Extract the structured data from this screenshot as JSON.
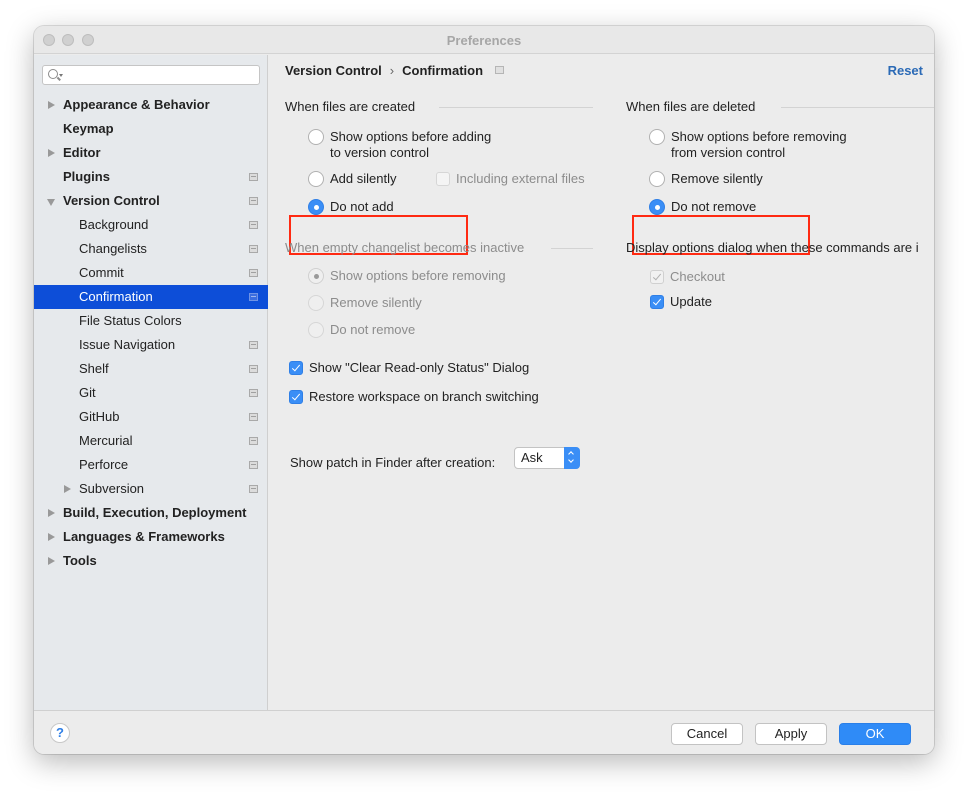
{
  "window": {
    "title": "Preferences"
  },
  "sidebar": {
    "search": {
      "placeholder": "",
      "value": ""
    },
    "items": [
      {
        "label": "Appearance & Behavior",
        "level": 0,
        "expander": "collapsed",
        "project_icon": false,
        "selected": false
      },
      {
        "label": "Keymap",
        "level": 0,
        "expander": "none",
        "project_icon": false,
        "selected": false
      },
      {
        "label": "Editor",
        "level": 0,
        "expander": "collapsed",
        "project_icon": false,
        "selected": false
      },
      {
        "label": "Plugins",
        "level": 0,
        "expander": "none",
        "project_icon": true,
        "selected": false
      },
      {
        "label": "Version Control",
        "level": 0,
        "expander": "expanded",
        "project_icon": true,
        "selected": false
      },
      {
        "label": "Background",
        "level": 1,
        "expander": "none",
        "project_icon": true,
        "selected": false
      },
      {
        "label": "Changelists",
        "level": 1,
        "expander": "none",
        "project_icon": true,
        "selected": false
      },
      {
        "label": "Commit",
        "level": 1,
        "expander": "none",
        "project_icon": true,
        "selected": false
      },
      {
        "label": "Confirmation",
        "level": 1,
        "expander": "none",
        "project_icon": true,
        "selected": true
      },
      {
        "label": "File Status Colors",
        "level": 1,
        "expander": "none",
        "project_icon": false,
        "selected": false
      },
      {
        "label": "Issue Navigation",
        "level": 1,
        "expander": "none",
        "project_icon": true,
        "selected": false
      },
      {
        "label": "Shelf",
        "level": 1,
        "expander": "none",
        "project_icon": true,
        "selected": false
      },
      {
        "label": "Git",
        "level": 1,
        "expander": "none",
        "project_icon": true,
        "selected": false
      },
      {
        "label": "GitHub",
        "level": 1,
        "expander": "none",
        "project_icon": true,
        "selected": false
      },
      {
        "label": "Mercurial",
        "level": 1,
        "expander": "none",
        "project_icon": true,
        "selected": false
      },
      {
        "label": "Perforce",
        "level": 1,
        "expander": "none",
        "project_icon": true,
        "selected": false
      },
      {
        "label": "Subversion",
        "level": 1,
        "expander": "collapsed",
        "project_icon": true,
        "selected": false
      },
      {
        "label": "Build, Execution, Deployment",
        "level": 0,
        "expander": "collapsed",
        "project_icon": false,
        "selected": false
      },
      {
        "label": "Languages & Frameworks",
        "level": 0,
        "expander": "collapsed",
        "project_icon": false,
        "selected": false
      },
      {
        "label": "Tools",
        "level": 0,
        "expander": "collapsed",
        "project_icon": false,
        "selected": false
      }
    ]
  },
  "content": {
    "breadcrumb": {
      "parent": "Version Control",
      "separator": "›",
      "current": "Confirmation"
    },
    "reset_label": "Reset",
    "files_created": {
      "title": "When files are created",
      "options": [
        {
          "label_line1": "Show options before adding",
          "label_line2": "to version control",
          "checked": false
        },
        {
          "label": "Add silently",
          "checked": false
        },
        {
          "label": "Do not add",
          "checked": true
        }
      ],
      "including_external": {
        "label": "Including external files",
        "checked": false,
        "enabled": false
      }
    },
    "files_deleted": {
      "title": "When files are deleted",
      "options": [
        {
          "label_line1": "Show options before removing",
          "label_line2": "from version control",
          "checked": false
        },
        {
          "label": "Remove silently",
          "checked": false
        },
        {
          "label": "Do not remove",
          "checked": true
        }
      ]
    },
    "empty_changelist": {
      "title": "When empty changelist becomes inactive",
      "enabled": false,
      "options": [
        {
          "label": "Show options before removing",
          "checked": true
        },
        {
          "label": "Remove silently",
          "checked": false
        },
        {
          "label": "Do not remove",
          "checked": false
        }
      ]
    },
    "display_options": {
      "title": "Display options dialog when these commands are i",
      "items": [
        {
          "label": "Checkout",
          "checked": true,
          "enabled": false
        },
        {
          "label": "Update",
          "checked": true,
          "enabled": true
        }
      ]
    },
    "checkboxes": [
      {
        "label": "Show \"Clear Read-only Status\" Dialog",
        "checked": true
      },
      {
        "label": "Restore workspace on branch switching",
        "checked": true
      }
    ],
    "show_patch": {
      "label": "Show patch in Finder after creation:",
      "value": "Ask"
    }
  },
  "footer": {
    "help_label": "?",
    "cancel_label": "Cancel",
    "apply_label": "Apply",
    "ok_label": "OK"
  },
  "colors": {
    "selection": "#0d4ed8",
    "accent": "#3a8ef6",
    "link": "#2b6ab6",
    "highlight_annotation": "#ff2a12"
  }
}
